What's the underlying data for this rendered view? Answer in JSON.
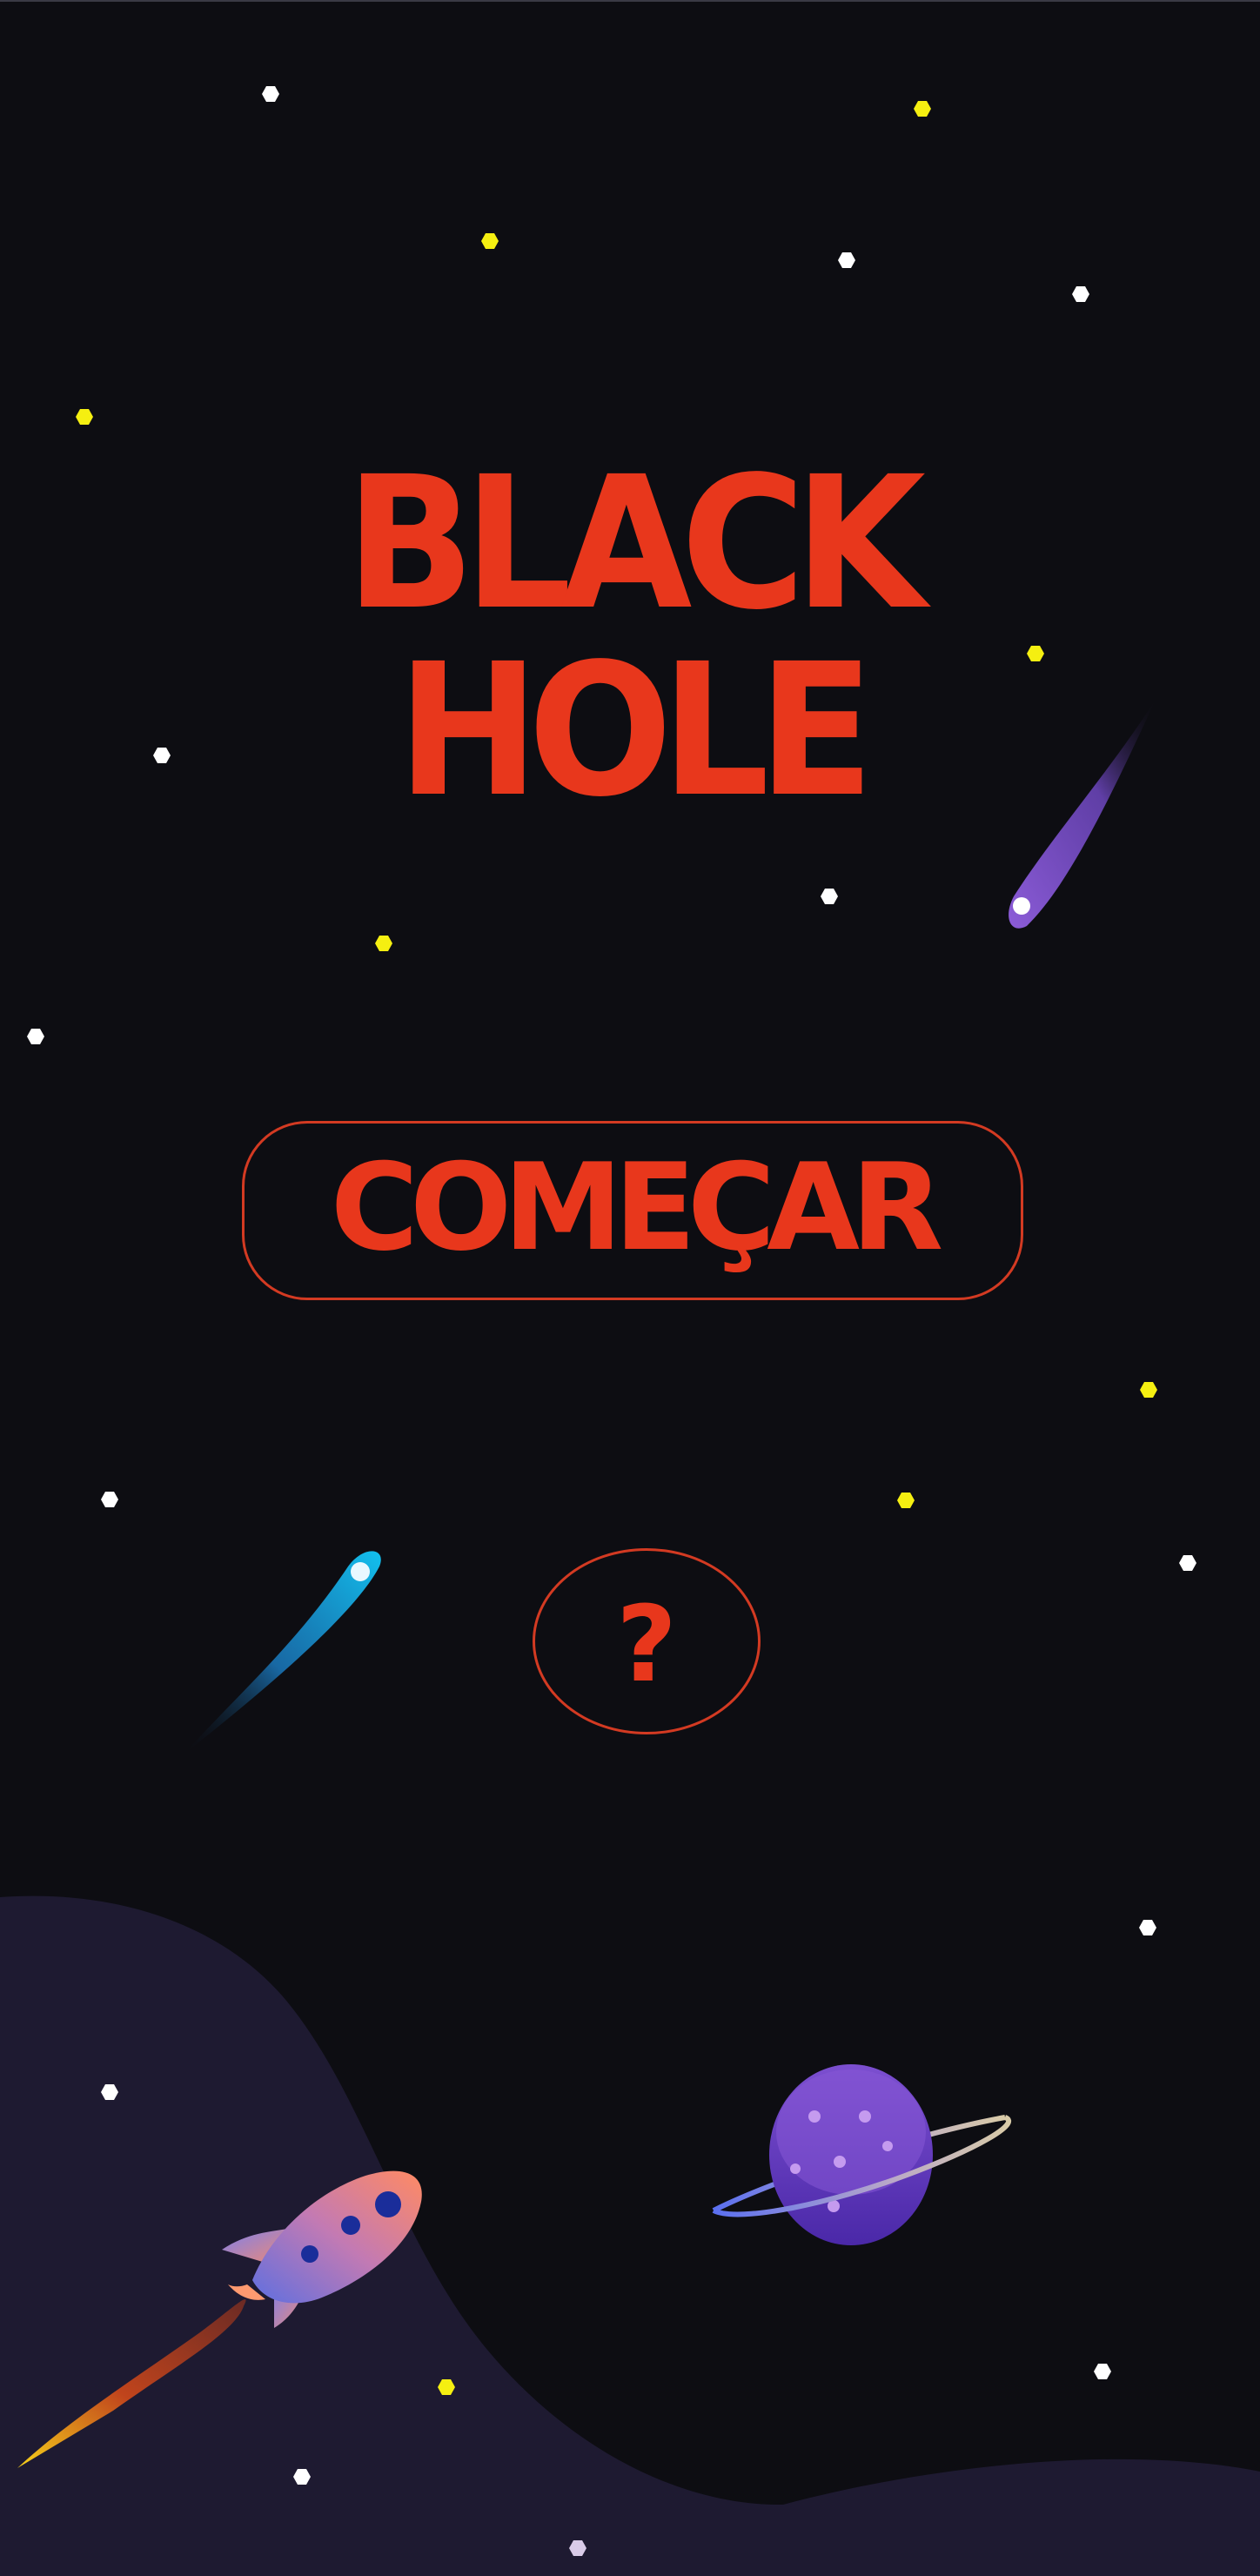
{
  "game": {
    "title_line1": "BLACK",
    "title_line2": "HOLE",
    "start_button_label": "COMEÇAR",
    "help_button_label": "?"
  },
  "colors": {
    "background": "#0d0d12",
    "accent": "#e8371c",
    "hill": "#1e1a31",
    "star_white": "#ffffff",
    "star_yellow": "#f5ef11"
  },
  "icons": {
    "start": "comecar-button",
    "help": "question-mark-icon",
    "decor": [
      "comet-icon",
      "planet-icon",
      "rocket-icon",
      "star-icon"
    ]
  }
}
